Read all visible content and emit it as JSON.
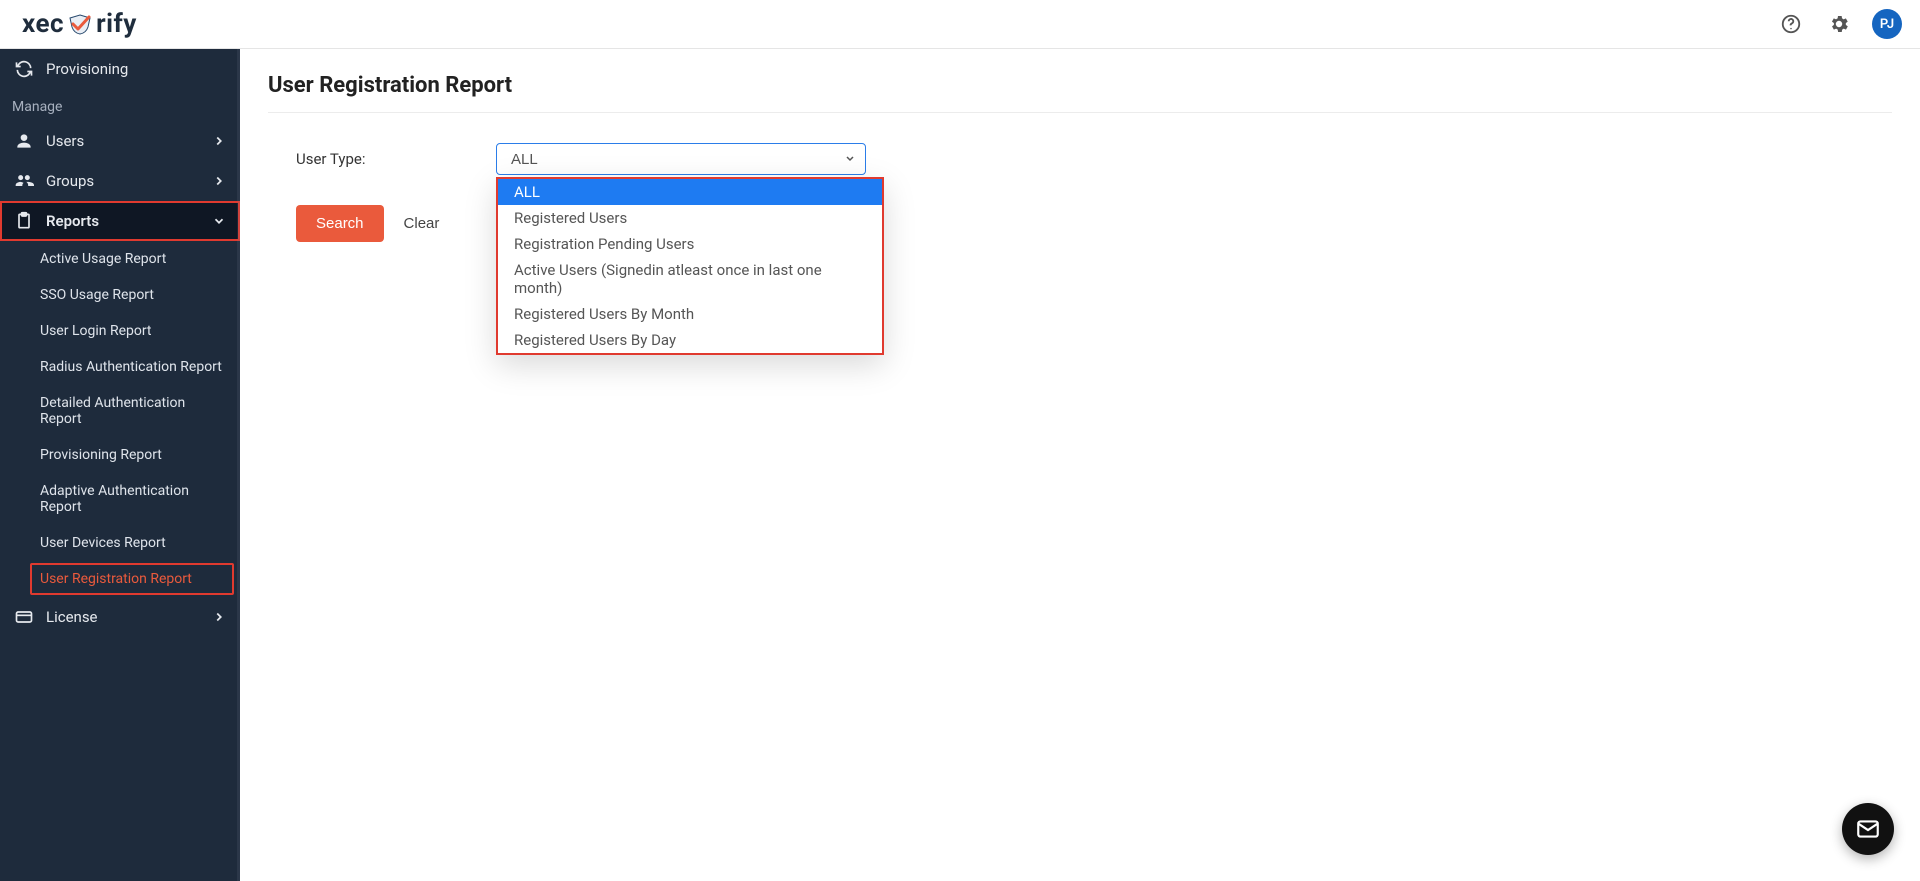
{
  "brand": {
    "name_left": "xec",
    "name_right": "rify"
  },
  "header": {
    "avatar_initials": "PJ"
  },
  "sidebar": {
    "provisioning": "Provisioning",
    "manage_header": "Manage",
    "users": "Users",
    "groups": "Groups",
    "reports": "Reports",
    "license": "License",
    "reports_items": [
      "Active Usage Report",
      "SSO Usage Report",
      "User Login Report",
      "Radius Authentication Report",
      "Detailed Authentication Report",
      "Provisioning Report",
      "Adaptive Authentication Report",
      "User Devices Report",
      "User Registration Report"
    ]
  },
  "main": {
    "title": "User Registration Report",
    "user_type_label": "User Type:",
    "selected_value": "ALL",
    "options": [
      "ALL",
      "Registered Users",
      "Registration Pending Users",
      "Active Users (Signedin atleast once in last one month)",
      "Registered Users By Month",
      "Registered Users By Day"
    ],
    "search_btn": "Search",
    "clear_btn": "Clear"
  }
}
